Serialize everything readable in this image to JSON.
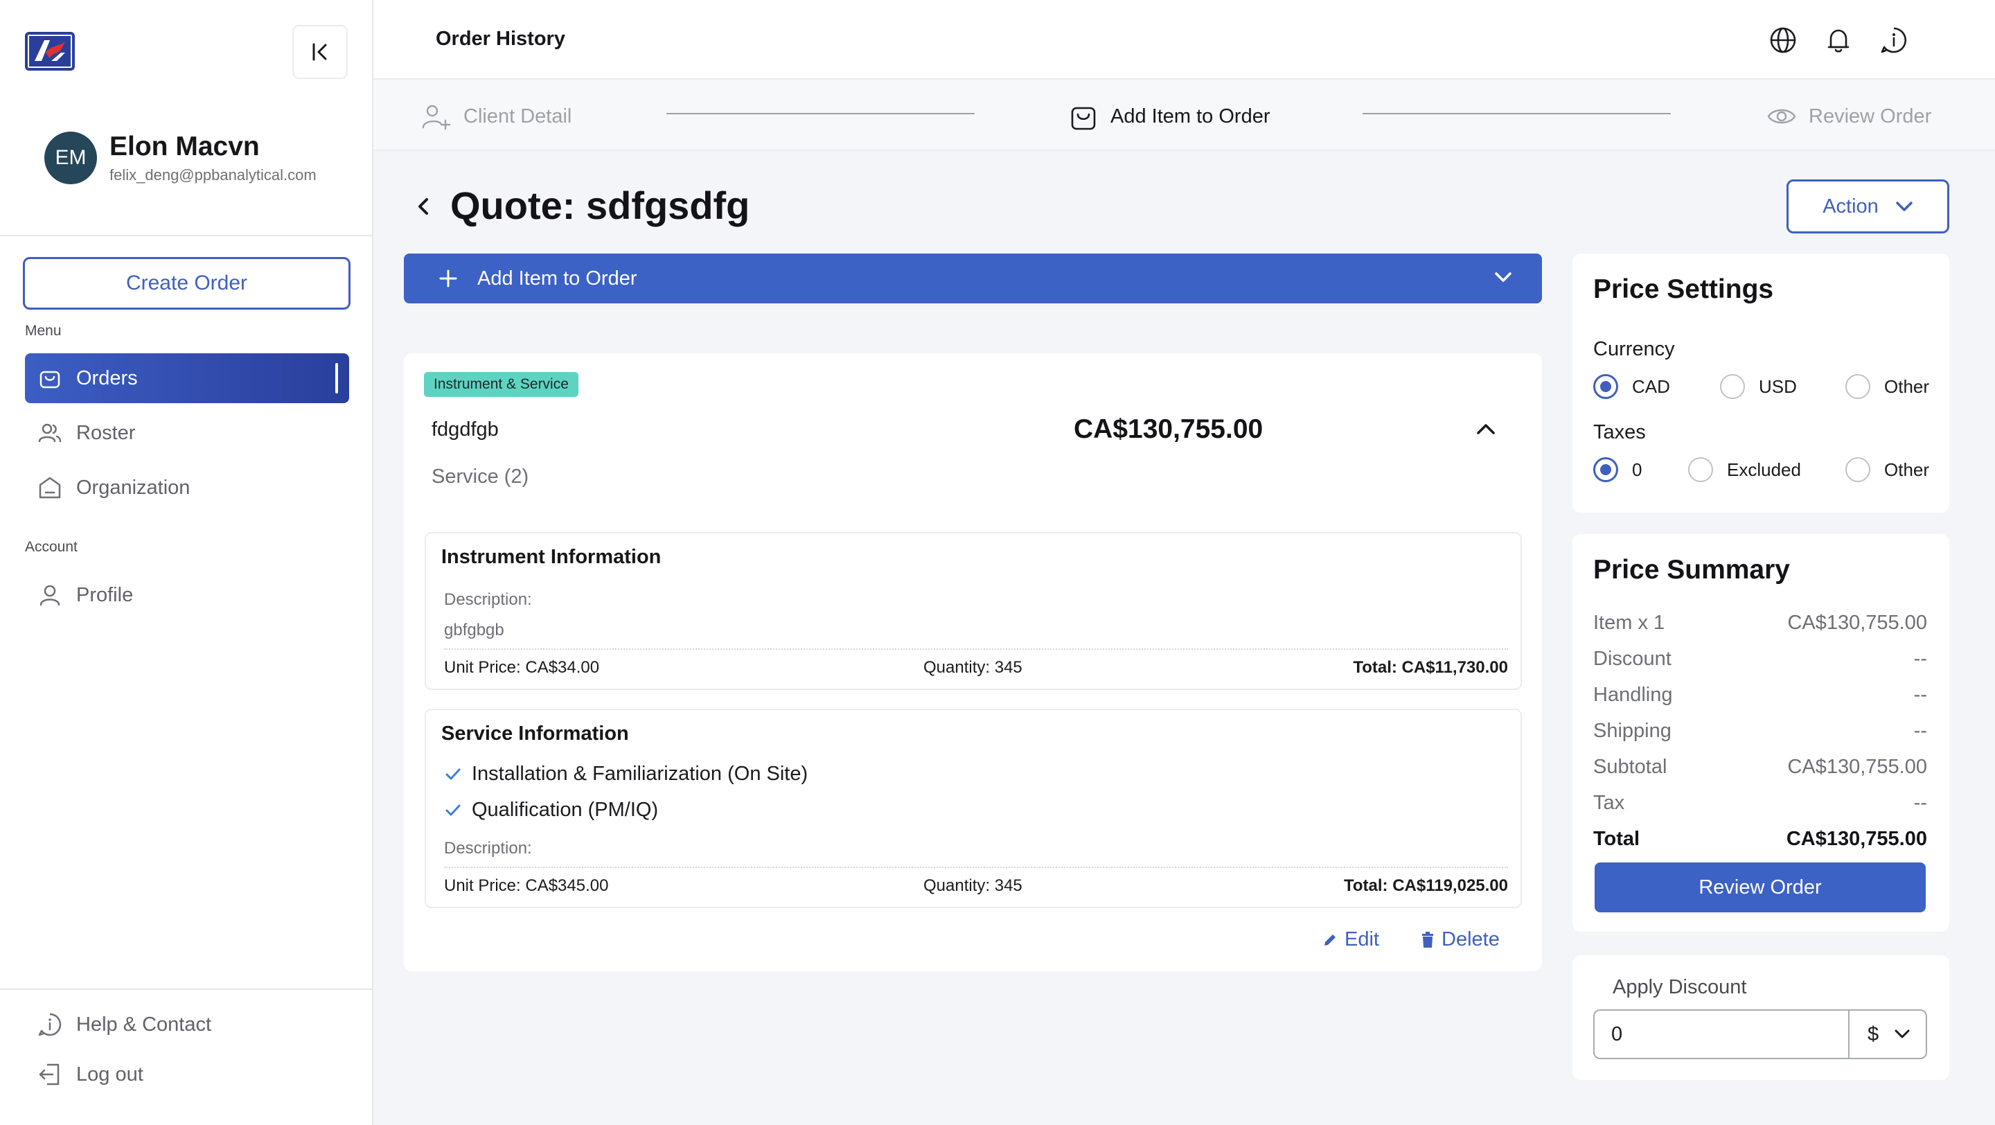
{
  "sidebar": {
    "user": {
      "initials": "EM",
      "name": "Elon Macvn",
      "email": "felix_deng@ppbanalytical.com"
    },
    "create_order_label": "Create Order",
    "menu_label": "Menu",
    "menu_items": [
      {
        "label": "Orders",
        "icon": "cart-icon",
        "active": true
      },
      {
        "label": "Roster",
        "icon": "users-icon",
        "active": false
      },
      {
        "label": "Organization",
        "icon": "building-icon",
        "active": false
      }
    ],
    "account_label": "Account",
    "account_items": [
      {
        "label": "Profile",
        "icon": "user-icon"
      }
    ],
    "bottom_items": [
      {
        "label": "Help & Contact",
        "icon": "info-icon"
      },
      {
        "label": "Log out",
        "icon": "logout-icon"
      }
    ]
  },
  "header": {
    "title": "Order History",
    "icons": [
      "globe-icon",
      "bell-icon",
      "info-icon"
    ]
  },
  "stepper": {
    "steps": [
      {
        "label": "Client Detail",
        "icon": "user-plus-icon",
        "state": "done"
      },
      {
        "label": "Add Item to Order",
        "icon": "cart-icon",
        "state": "current"
      },
      {
        "label": "Review Order",
        "icon": "eye-icon",
        "state": "upcoming"
      }
    ]
  },
  "quote": {
    "title": "Quote: sdfgsdfg",
    "action_label": "Action",
    "add_item_label": "Add Item to Order"
  },
  "item": {
    "badge": "Instrument & Service",
    "name": "fdgdfgb",
    "price": "CA$130,755.00",
    "subtitle": "Service (2)",
    "instrument": {
      "title": "Instrument Information",
      "description_label": "Description:",
      "description": "gbfgbgb",
      "unit_price": "Unit Price: CA$34.00",
      "quantity": "Quantity: 345",
      "total": "Total: CA$11,730.00"
    },
    "service": {
      "title": "Service Information",
      "services": [
        "Installation & Familiarization (On Site)",
        "Qualification (PM/IQ)"
      ],
      "description_label": "Description:",
      "unit_price": "Unit Price: CA$345.00",
      "quantity": "Quantity: 345",
      "total": "Total: CA$119,025.00"
    },
    "edit_label": "Edit",
    "delete_label": "Delete"
  },
  "price_settings": {
    "title": "Price Settings",
    "currency_label": "Currency",
    "currency_options": [
      "CAD",
      "USD",
      "Other"
    ],
    "currency_selected": "CAD",
    "taxes_label": "Taxes",
    "tax_options": [
      "0",
      "Excluded",
      "Other"
    ],
    "tax_selected": "0"
  },
  "price_summary": {
    "title": "Price Summary",
    "rows": [
      {
        "label": "Item x 1",
        "value": "CA$130,755.00"
      },
      {
        "label": "Discount",
        "value": "--"
      },
      {
        "label": "Handling",
        "value": "--"
      },
      {
        "label": "Shipping",
        "value": "--"
      },
      {
        "label": "Subtotal",
        "value": "CA$130,755.00"
      },
      {
        "label": "Tax",
        "value": "--"
      }
    ],
    "total_label": "Total",
    "total_value": "CA$130,755.00",
    "review_button": "Review Order"
  },
  "discount": {
    "label": "Apply Discount",
    "value": "0",
    "unit": "$"
  },
  "colors": {
    "primary": "#3d62c5",
    "badge": "#5ed3c2",
    "avatar": "#264659"
  }
}
